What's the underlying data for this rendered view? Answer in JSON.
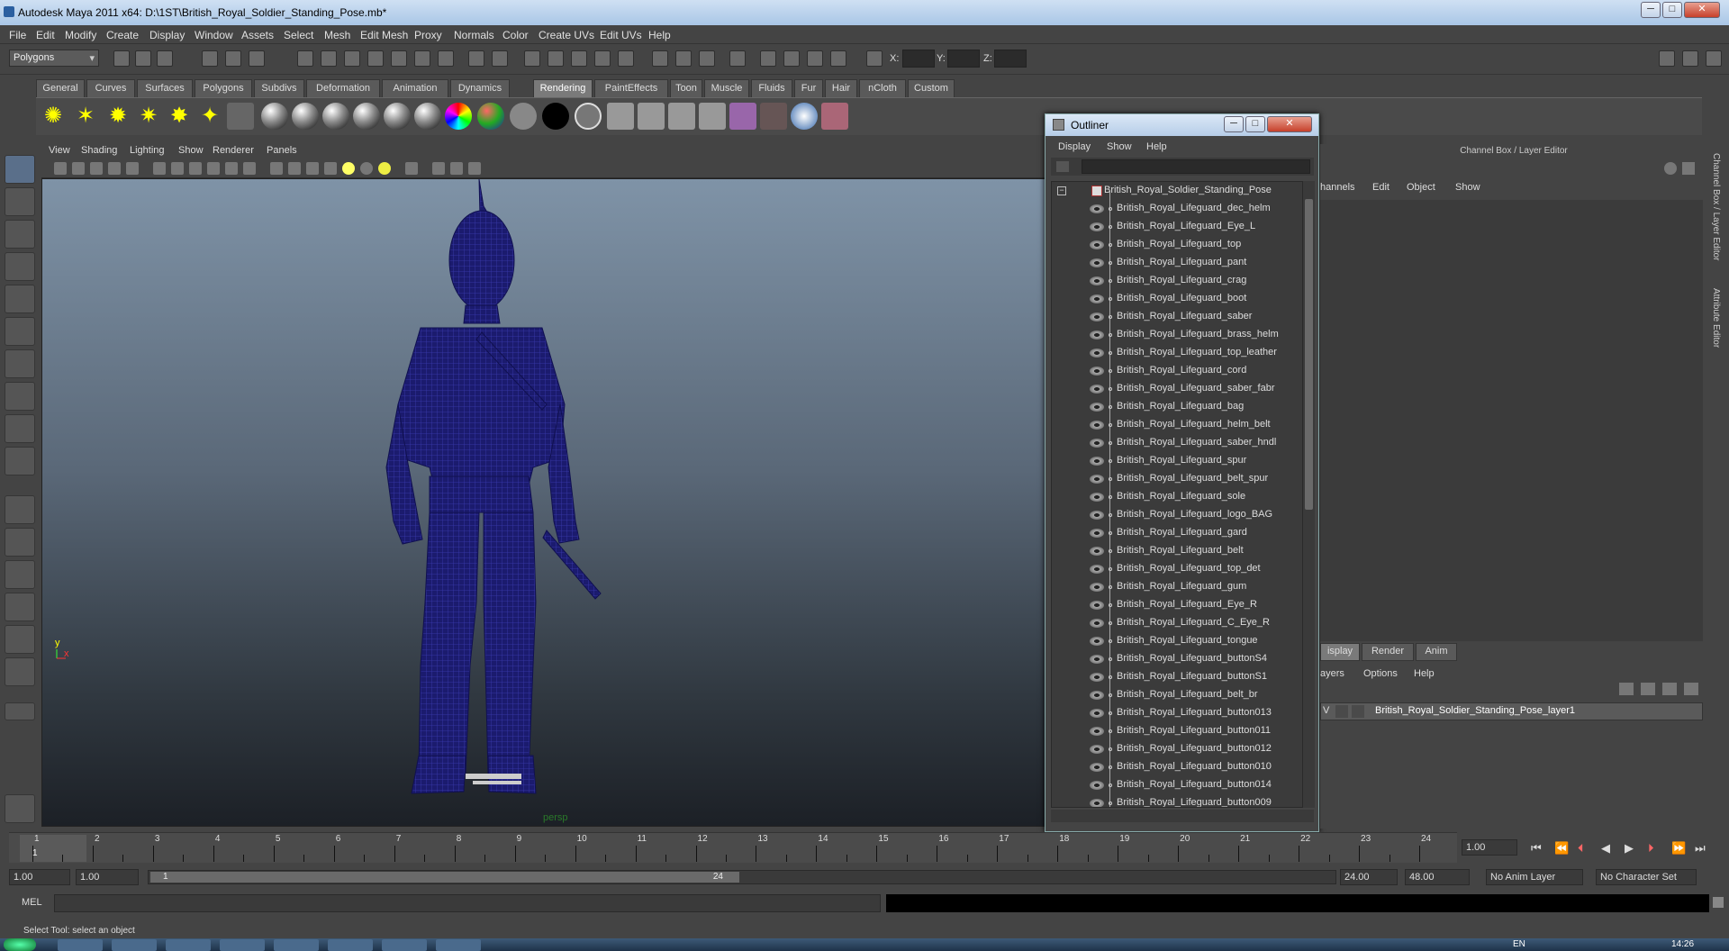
{
  "window": {
    "title": "Autodesk Maya 2011 x64: D:\\1ST\\British_Royal_Soldier_Standing_Pose.mb*",
    "min": "─",
    "max": "□",
    "close": "✕"
  },
  "menubar": [
    "File",
    "Edit",
    "Modify",
    "Create",
    "Display",
    "Window",
    "Assets",
    "Select",
    "Mesh",
    "Edit Mesh",
    "Proxy",
    "Normals",
    "Color",
    "Create UVs",
    "Edit UVs",
    "Help"
  ],
  "statusline": {
    "mode": "Polygons",
    "x_label": "X:",
    "y_label": "Y:",
    "z_label": "Z:"
  },
  "shelf_tabs": [
    "General",
    "Curves",
    "Surfaces",
    "Polygons",
    "Subdivs",
    "Deformation",
    "Animation",
    "Dynamics",
    "Rendering",
    "PaintEffects",
    "Toon",
    "Muscle",
    "Fluids",
    "Fur",
    "Hair",
    "nCloth",
    "Custom"
  ],
  "active_shelf_tab": "Rendering",
  "panel_menu": [
    "View",
    "Shading",
    "Lighting",
    "Show",
    "Renderer",
    "Panels"
  ],
  "viewport": {
    "camera_label": "persp",
    "axis_y": "y",
    "axis_x": "x",
    "wire_color": "#1a1a7a"
  },
  "outliner": {
    "title": "Outliner",
    "menu": [
      "Display",
      "Show",
      "Help"
    ],
    "root": "British_Royal_Soldier_Standing_Pose",
    "items": [
      "British_Royal_Lifeguard_dec_helm",
      "British_Royal_Lifeguard_Eye_L",
      "British_Royal_Lifeguard_top",
      "British_Royal_Lifeguard_pant",
      "British_Royal_Lifeguard_crag",
      "British_Royal_Lifeguard_boot",
      "British_Royal_Lifeguard_saber",
      "British_Royal_Lifeguard_brass_helm",
      "British_Royal_Lifeguard_top_leather",
      "British_Royal_Lifeguard_cord",
      "British_Royal_Lifeguard_saber_fabr",
      "British_Royal_Lifeguard_bag",
      "British_Royal_Lifeguard_helm_belt",
      "British_Royal_Lifeguard_saber_hndl",
      "British_Royal_Lifeguard_spur",
      "British_Royal_Lifeguard_belt_spur",
      "British_Royal_Lifeguard_sole",
      "British_Royal_Lifeguard_logo_BAG",
      "British_Royal_Lifeguard_gard",
      "British_Royal_Lifeguard_belt",
      "British_Royal_Lifeguard_top_det",
      "British_Royal_Lifeguard_gum",
      "British_Royal_Lifeguard_Eye_R",
      "British_Royal_Lifeguard_C_Eye_R",
      "British_Royal_Lifeguard_tongue",
      "British_Royal_Lifeguard_buttonS4",
      "British_Royal_Lifeguard_buttonS1",
      "British_Royal_Lifeguard_belt_br",
      "British_Royal_Lifeguard_button013",
      "British_Royal_Lifeguard_button011",
      "British_Royal_Lifeguard_button012",
      "British_Royal_Lifeguard_button010",
      "British_Royal_Lifeguard_button014",
      "British_Royal_Lifeguard_button009"
    ]
  },
  "channelbox": {
    "title": "Channel Box / Layer Editor",
    "menu": [
      "hannels",
      "Edit",
      "Object",
      "Show"
    ],
    "tabs": [
      "isplay",
      "Render",
      "Anim"
    ],
    "layer_menu": [
      "ayers",
      "Options",
      "Help"
    ],
    "layer_v": "V",
    "layer_name": "British_Royal_Soldier_Standing_Pose_layer1"
  },
  "side_labels": [
    "Channel Box / Layer Editor",
    "Attribute Editor"
  ],
  "timeline": {
    "ticks": [
      "1",
      "2",
      "3",
      "4",
      "5",
      "6",
      "7",
      "8",
      "9",
      "10",
      "11",
      "12",
      "13",
      "14",
      "15",
      "16",
      "17",
      "18",
      "19",
      "20",
      "21",
      "22",
      "23",
      "24"
    ],
    "current": "1",
    "current_field": "1.00"
  },
  "range": {
    "start": "1.00",
    "start2": "1.00",
    "range_start": "1",
    "range_end": "24",
    "end": "24.00",
    "end2": "48.00",
    "anim_layer": "No Anim Layer",
    "char_set": "No Character Set"
  },
  "mel": {
    "label": "MEL"
  },
  "help_line": "Select Tool: select an object",
  "taskbar": {
    "lang": "EN",
    "clock": "14:26"
  }
}
